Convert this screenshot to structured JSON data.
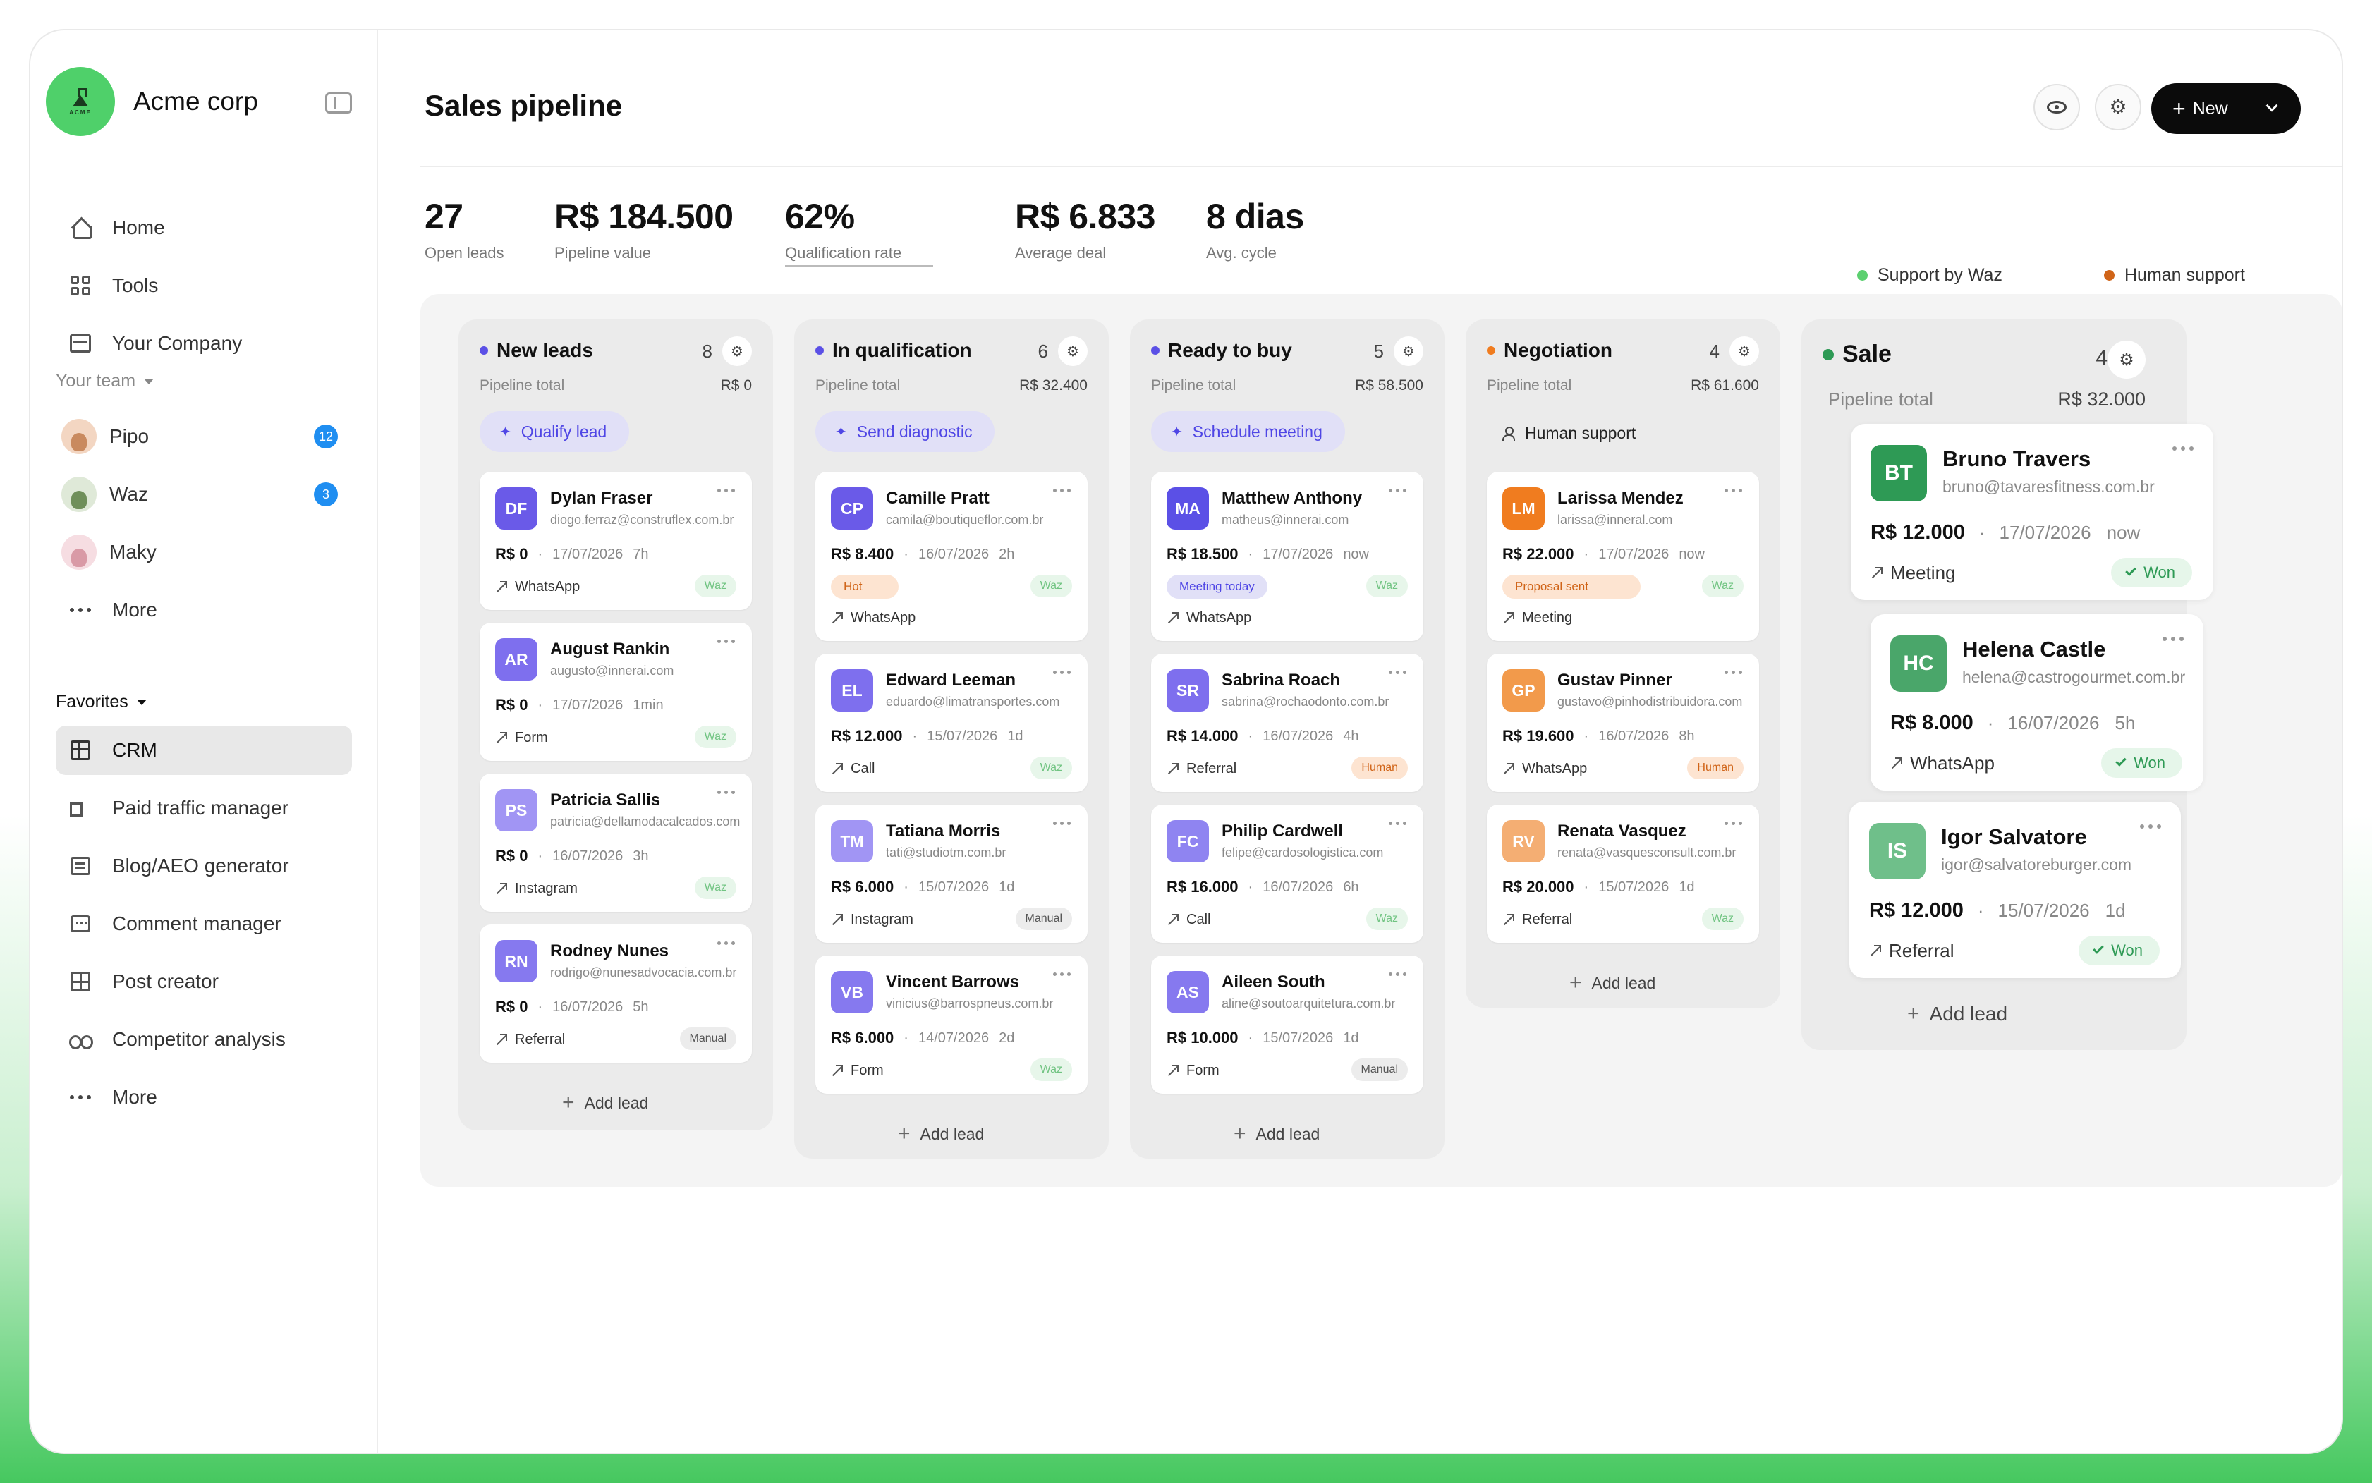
{
  "brand": {
    "name": "Acme corp",
    "logo_word": "ACME"
  },
  "nav": [
    {
      "label": "Home"
    },
    {
      "label": "Tools"
    },
    {
      "label": "Your Company"
    }
  ],
  "team": {
    "label": "Your team",
    "members": [
      {
        "name": "Pipo",
        "count": "12"
      },
      {
        "name": "Waz",
        "count": "3"
      },
      {
        "name": "Maky"
      }
    ],
    "more": "More"
  },
  "favorites": {
    "label": "Favorites",
    "items": [
      {
        "label": "CRM"
      },
      {
        "label": "Paid traffic manager"
      },
      {
        "label": "Blog/AEO generator"
      },
      {
        "label": "Comment manager"
      },
      {
        "label": "Post creator"
      },
      {
        "label": "Competitor analysis"
      }
    ],
    "more": "More"
  },
  "header": {
    "title": "Sales pipeline",
    "new_label": "New"
  },
  "stats": [
    {
      "value": "27",
      "label": "Open leads"
    },
    {
      "value": "R$ 184.500",
      "label": "Pipeline value"
    },
    {
      "value": "62%",
      "label": "Qualification rate"
    },
    {
      "value": "R$ 6.833",
      "label": "Average deal"
    },
    {
      "value": "8 dias",
      "label": "Avg. cycle"
    }
  ],
  "legend": [
    {
      "label": "Support by Waz",
      "color": "#5cd070"
    },
    {
      "label": "Human support",
      "color": "#d06418"
    }
  ],
  "columns": [
    {
      "title": "New leads",
      "count": "8",
      "sub": "Pipeline total",
      "total": "R$ 0",
      "action": "Qualify lead",
      "add": "Add lead",
      "cards": [
        {
          "initials": "DF",
          "name": "Dylan Fraser",
          "email": "diogo.ferraz@construflex.com.br",
          "amount": "R$ 0",
          "date": "17/07/2026",
          "age": "7h",
          "source": "WhatsApp",
          "tag": "Waz"
        },
        {
          "initials": "AR",
          "name": "August Rankin",
          "email": "augusto@innerai.com",
          "amount": "R$ 0",
          "date": "17/07/2026",
          "age": "1min",
          "source": "Form",
          "tag": "Waz"
        },
        {
          "initials": "PS",
          "name": "Patricia Sallis",
          "email": "patricia@dellamodacalcados.com",
          "amount": "R$ 0",
          "date": "16/07/2026",
          "age": "3h",
          "source": "Instagram",
          "tag": "Waz"
        },
        {
          "initials": "RN",
          "name": "Rodney Nunes",
          "email": "rodrigo@nunesadvocacia.com.br",
          "amount": "R$ 0",
          "date": "16/07/2026",
          "age": "5h",
          "source": "Referral",
          "tag": "Manual"
        }
      ]
    },
    {
      "title": "In qualification",
      "count": "6",
      "sub": "Pipeline total",
      "total": "R$ 32.400",
      "action": "Send diagnostic",
      "add": "Add lead",
      "cards": [
        {
          "initials": "CP",
          "name": "Camille Pratt",
          "email": "camila@boutiqueflor.com.br",
          "amount": "R$ 8.400",
          "date": "16/07/2026",
          "age": "2h",
          "source": "WhatsApp",
          "tag": "Waz",
          "status": "Hot"
        },
        {
          "initials": "EL",
          "name": "Edward Leeman",
          "email": "eduardo@limatransportes.com",
          "amount": "R$ 12.000",
          "date": "15/07/2026",
          "age": "1d",
          "source": "Call",
          "tag": "Waz"
        },
        {
          "initials": "TM",
          "name": "Tatiana Morris",
          "email": "tati@studiotm.com.br",
          "amount": "R$ 6.000",
          "date": "15/07/2026",
          "age": "1d",
          "source": "Instagram",
          "tag": "Manual"
        },
        {
          "initials": "VB",
          "name": "Vincent Barrows",
          "email": "vinicius@barrospneus.com.br",
          "amount": "R$ 6.000",
          "date": "14/07/2026",
          "age": "2d",
          "source": "Form",
          "tag": "Waz"
        }
      ]
    },
    {
      "title": "Ready to buy",
      "count": "5",
      "sub": "Pipeline total",
      "total": "R$ 58.500",
      "action": "Schedule meeting",
      "add": "Add lead",
      "cards": [
        {
          "initials": "MA",
          "name": "Matthew Anthony",
          "email": "matheus@innerai.com",
          "amount": "R$ 18.500",
          "date": "17/07/2026",
          "age": "now",
          "source": "WhatsApp",
          "tag": "Waz",
          "status": "Meeting today"
        },
        {
          "initials": "SR",
          "name": "Sabrina Roach",
          "email": "sabrina@rochaodonto.com.br",
          "amount": "R$ 14.000",
          "date": "16/07/2026",
          "age": "4h",
          "source": "Referral",
          "tag": "Human"
        },
        {
          "initials": "FC",
          "name": "Philip Cardwell",
          "email": "felipe@cardosologistica.com",
          "amount": "R$ 16.000",
          "date": "16/07/2026",
          "age": "6h",
          "source": "Call",
          "tag": "Waz"
        },
        {
          "initials": "AS",
          "name": "Aileen South",
          "email": "aline@soutoarquitetura.com.br",
          "amount": "R$ 10.000",
          "date": "15/07/2026",
          "age": "1d",
          "source": "Form",
          "tag": "Manual"
        }
      ]
    },
    {
      "title": "Negotiation",
      "count": "4",
      "sub": "Pipeline total",
      "total": "R$ 61.600",
      "action": "Human support",
      "add": "Add lead",
      "cards": [
        {
          "initials": "LM",
          "name": "Larissa Mendez",
          "email": "larissa@inneral.com",
          "amount": "R$ 22.000",
          "date": "17/07/2026",
          "age": "now",
          "source": "Meeting",
          "tag": "Waz",
          "status": "Proposal sent"
        },
        {
          "initials": "GP",
          "name": "Gustav Pinner",
          "email": "gustavo@pinhodistribuidora.com",
          "amount": "R$ 19.600",
          "date": "16/07/2026",
          "age": "8h",
          "source": "WhatsApp",
          "tag": "Human"
        },
        {
          "initials": "RV",
          "name": "Renata Vasquez",
          "email": "renata@vasquesconsult.com.br",
          "amount": "R$ 20.000",
          "date": "15/07/2026",
          "age": "1d",
          "source": "Referral",
          "tag": "Waz"
        }
      ]
    },
    {
      "title": "Sale",
      "count": "4",
      "sub": "Pipeline total",
      "total": "R$ 32.000",
      "add": "Add lead",
      "cards": [
        {
          "initials": "BT",
          "name": "Bruno Travers",
          "email": "bruno@tavaresfitness.com.br",
          "amount": "R$ 12.000",
          "date": "17/07/2026",
          "age": "now",
          "source": "Meeting",
          "tag": "Won"
        },
        {
          "initials": "HC",
          "name": "Helena Castle",
          "email": "helena@castrogourmet.com.br",
          "amount": "R$ 8.000",
          "date": "16/07/2026",
          "age": "5h",
          "source": "WhatsApp",
          "tag": "Won"
        },
        {
          "initials": "IS",
          "name": "Igor Salvatore",
          "email": "igor@salvatoreburger.com",
          "amount": "R$ 12.000",
          "date": "15/07/2026",
          "age": "1d",
          "source": "Referral",
          "tag": "Won"
        }
      ]
    }
  ],
  "colors": {
    "purple": "#5b50e6",
    "green": "#2e9a55",
    "orange": "#f07c1f",
    "accent_green": "#4fd06a"
  }
}
